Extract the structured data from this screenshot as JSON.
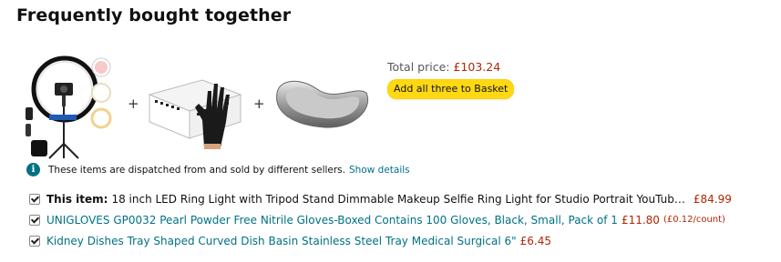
{
  "section": {
    "title": "Frequently bought together"
  },
  "summary": {
    "total_label": "Total price:",
    "total_price": "£103.24",
    "add_button": "Add all three to Basket"
  },
  "notice": {
    "text": "These items are dispatched from and sold by different sellers.",
    "link": "Show details",
    "icon": "info-icon"
  },
  "items": [
    {
      "prefix": "This item:",
      "title": "18 inch LED Ring Light with Tripod Stand Dimmable Makeup Selfie Ring Light for Studio Portrait YouTub…",
      "price": "£84.99",
      "unit_price": "",
      "checked": true
    },
    {
      "prefix": "",
      "title": "UNIGLOVES GP0032 Pearl Powder Free Nitrile Gloves-Boxed Contains 100 Gloves, Black, Small, Pack of 1",
      "price": "£11.80",
      "unit_price": "(£0.12/count)",
      "checked": true
    },
    {
      "prefix": "",
      "title": "Kidney Dishes Tray Shaped Curved Dish Basin Stainless Steel Tray Medical Surgical 6\"",
      "price": "£6.45",
      "unit_price": "",
      "checked": true
    }
  ],
  "colors": {
    "link": "#007185",
    "price": "#b12704",
    "button": "#ffd814"
  }
}
